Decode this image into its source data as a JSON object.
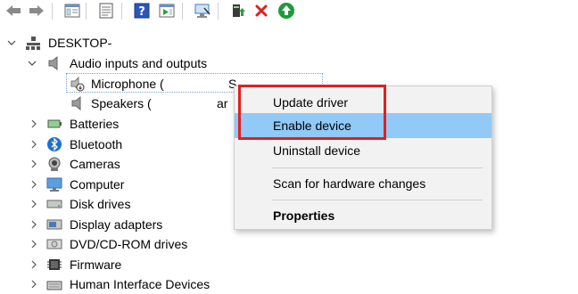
{
  "toolbar": {
    "buttons": [
      {
        "name": "back-icon"
      },
      {
        "name": "forward-icon"
      },
      {
        "name": "show-hide-console-tree-icon"
      },
      {
        "name": "properties-icon"
      },
      {
        "name": "help-icon"
      },
      {
        "name": "action-pane-icon"
      },
      {
        "name": "scan-hardware-icon"
      },
      {
        "name": "update-driver-icon"
      },
      {
        "name": "uninstall-device-icon"
      },
      {
        "name": "enable-device-icon"
      }
    ]
  },
  "tree": {
    "root": "DESKTOP-",
    "audio_category": "Audio inputs and outputs",
    "microphone": "Microphone (",
    "microphone_suffix": "S",
    "speakers": "Speakers (",
    "speakers_suffix": "ar",
    "categories": [
      "Batteries",
      "Bluetooth",
      "Cameras",
      "Computer",
      "Disk drives",
      "Display adapters",
      "DVD/CD-ROM drives",
      "Firmware",
      "Human Interface Devices"
    ]
  },
  "context_menu": {
    "update_driver": "Update driver",
    "enable_device": "Enable device",
    "uninstall_device": "Uninstall device",
    "scan_hardware": "Scan for hardware changes",
    "properties": "Properties"
  },
  "colors": {
    "highlight": "#91c9f7",
    "annotation_red": "#e02020",
    "menu_bg": "#f2f2f2"
  }
}
